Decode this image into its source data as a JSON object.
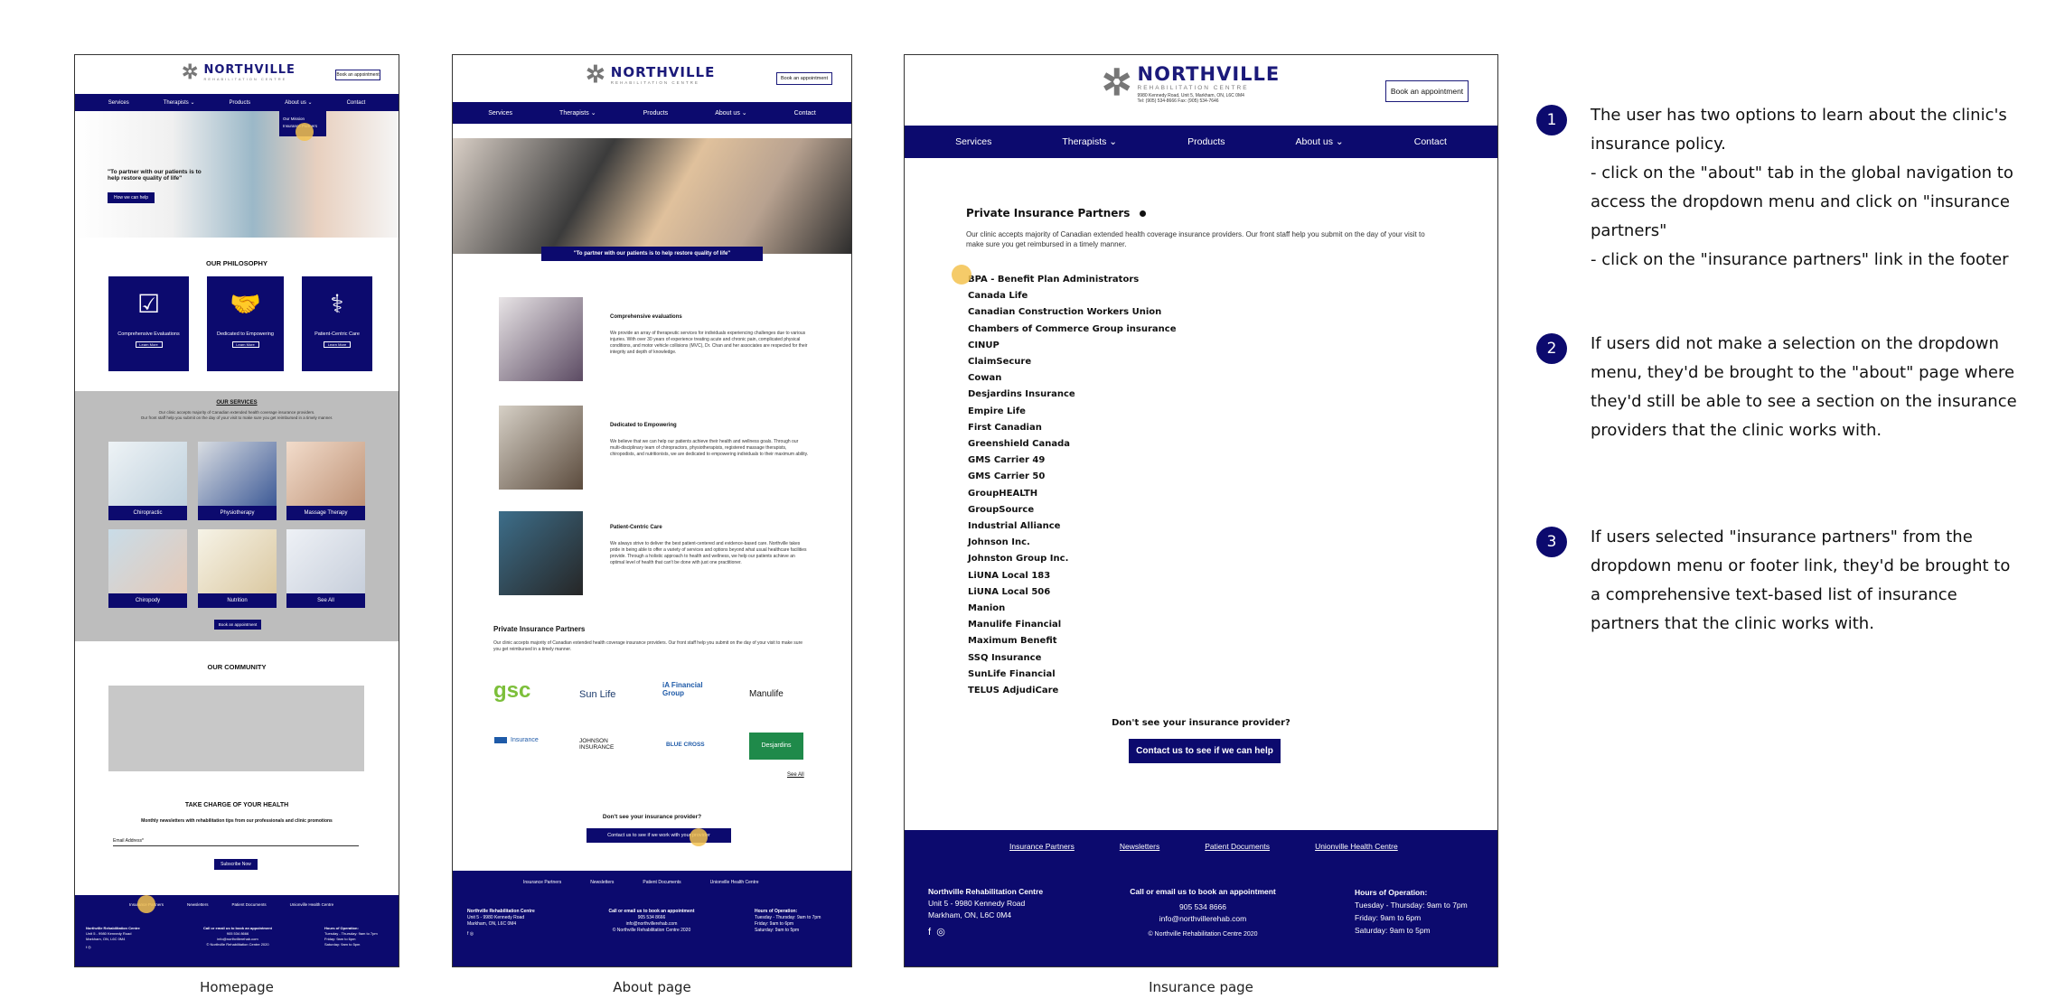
{
  "brand": {
    "name": "NORTHVILLE",
    "sub": "REHABILITATION CENTRE",
    "address_line": "9980 Kennedy Road, Unit 5, Markham, ON, L6C 0M4",
    "phones": "Tel: (905) 534-8666   Fax: (905) 534-7646"
  },
  "book_button": "Book an appointment",
  "nav": {
    "services": "Services",
    "therapists": "Therapists",
    "products": "Products",
    "about": "About us",
    "contact": "Contact",
    "chevron": "chevron-down-icon"
  },
  "home": {
    "dropdown": [
      "Our Mission",
      "Insurance Partners"
    ],
    "hero_quote": "\"To partner with our patients is to help restore quality of life\"",
    "hero_button": "How we can help",
    "philosophy_title": "OUR PHILOSOPHY",
    "cards": [
      {
        "label": "Comprehensive Evaluations",
        "icon": "checklist-icon"
      },
      {
        "label": "Dedicated to Empowering",
        "icon": "handshake-icon"
      },
      {
        "label": "Patient-Centric Care",
        "icon": "stethoscope-icon"
      }
    ],
    "learn_more": "Learn More",
    "services_title": "OUR SERVICES",
    "services_sub1": "Our clinic accepts majority of Canadian extended health coverage insurance providers.",
    "services_sub2": "Our front staff help you submit on the day of your visit to make sure you get reimbursed in a timely manner.",
    "tiles": [
      "Chiropractic",
      "Physiotherapy",
      "Massage Therapy",
      "Chiropody",
      "Nutrition",
      "See All"
    ],
    "services_button": "Book an appointment",
    "community_title": "OUR COMMUNITY",
    "newsletter_title": "TAKE CHARGE OF YOUR HEALTH",
    "newsletter_sub": "Monthly newsletters with rehabilitation tips from our professionals and clinic promotions",
    "email_placeholder": "Email Address*",
    "subscribe": "Subscribe Now"
  },
  "about": {
    "hero_quote": "\"To partner with our patients is to help restore quality of life\"",
    "items": [
      {
        "title": "Comprehensive evaluations",
        "text": "We provide an array of therapeutic services for individuals experiencing challenges due to various injuries. With over 30 years of experience treating acute and chronic pain, complicated physical conditions, and motor vehicle collisions (MVC), Dr. Chan and her associates are respected for their integrity and depth of knowledge."
      },
      {
        "title": "Dedicated to Empowering",
        "text": "We believe that we can help our patients achieve their health and wellness goals. Through our multi-disciplinary team of chiropractors, physiotherapists, registered massage therapists, chiropodists, and nutritionists, we are dedicated to empowering individuals to their maximum ability."
      },
      {
        "title": "Patient-Centric Care",
        "text": "We always strive to deliver the best patient-centered and evidence-based care. Northville takes pride in being able to offer a variety of services and options beyond what usual healthcare facilities provide. Through a holistic approach to health and wellness, we help our patients achieve an optimal level of health that can't be done with just one practitioner."
      }
    ],
    "partners_title": "Private Insurance Partners",
    "partners_text": "Our clinic accepts majority of Canadian extended health coverage insurance providers. Our front staff help you submit on the day of your visit to make sure you get reimbursed in a timely manner.",
    "logos": [
      "gsc",
      "Sun Life",
      "iA Financial Group",
      "Manulife",
      "Insurance",
      "JOHNSON INSURANCE",
      "BLUE CROSS",
      "Desjardins"
    ],
    "see_all": "See All",
    "dont_see": "Don't see your insurance provider?",
    "contact_button": "Contact us to see if we work with your provider"
  },
  "insurance": {
    "title": "Private Insurance Partners",
    "intro": "Our clinic accepts majority of Canadian extended health coverage insurance providers. Our front staff help you submit on the day of your visit to make sure you get reimbursed in a timely manner.",
    "list": [
      "BPA - Benefit Plan Administrators",
      "Canada Life",
      "Canadian Construction Workers Union",
      "Chambers of Commerce Group insurance",
      "CINUP",
      "ClaimSecure",
      "Cowan",
      "Desjardins Insurance",
      "Empire Life",
      "First Canadian",
      "Greenshield Canada",
      "GMS Carrier 49",
      "GMS Carrier 50",
      "GroupHEALTH",
      "GroupSource",
      "Industrial Alliance",
      "Johnson Inc.",
      "Johnston Group Inc.",
      "LiUNA Local 183",
      "LiUNA Local 506",
      "Manion",
      "Manulife Financial",
      "Maximum Benefit",
      "SSQ Insurance",
      "SunLife Financial",
      "TELUS AdjudiCare"
    ],
    "dont_see": "Don't see your insurance provider?",
    "contact_button": "Contact us to see if we can help"
  },
  "footer": {
    "links": [
      "Insurance Partners",
      "Newsletters",
      "Patient Documents",
      "Unionville Health Centre"
    ],
    "clinic_name": "Northville Rehabilitation Centre",
    "address1": "Unit 5 - 9980 Kennedy Road",
    "address2": "Markham, ON, L6C 0M4",
    "call_title": "Call or email us to book an appointment",
    "phone": "905 534 8666",
    "email": "info@northvillerehab.com",
    "copyright": "© Northville Rehabilitation Centre 2020",
    "hours_title": "Hours of Operation:",
    "hours": [
      "Tuesday - Thursday: 9am to 7pm",
      "Friday: 9am to 6pm",
      "Saturday: 9am to 5pm"
    ],
    "social": [
      "facebook-icon",
      "instagram-icon"
    ]
  },
  "captions": [
    "Homepage",
    "About page",
    "Insurance page"
  ],
  "steps": [
    {
      "num": "1",
      "text": "The user has two options to learn about the clinic's insurance policy.\n- click on the \"about\" tab in the global navigation to access the dropdown menu and click on \"insurance partners\"\n- click on the \"insurance partners\" link in the footer"
    },
    {
      "num": "2",
      "text": "If users did not make a selection on the dropdown menu, they'd be brought to the \"about\" page where they'd still be able to see a section on the insurance providers that the clinic works with."
    },
    {
      "num": "3",
      "text": "If users selected \"insurance partners\" from the dropdown menu or footer link, they'd be brought to a comprehensive text-based list of insurance partners that the clinic works with."
    }
  ],
  "colors": {
    "navy": "#0c0a6e",
    "highlight": "#f3c24f",
    "grey_band": "#bdbdbd"
  }
}
